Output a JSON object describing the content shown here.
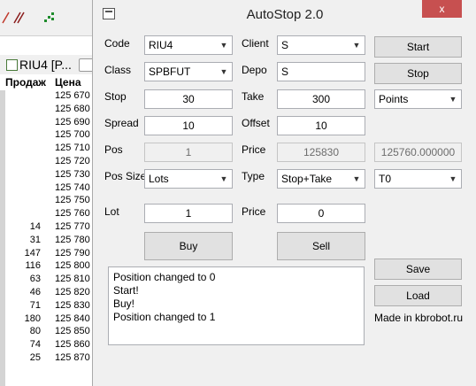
{
  "background_app": {
    "tab_label": "RIU4 [P...",
    "header_sell": "Продаж",
    "header_price": "Цена",
    "rows": [
      {
        "qty": "",
        "price": "125 670"
      },
      {
        "qty": "",
        "price": "125 680"
      },
      {
        "qty": "",
        "price": "125 690"
      },
      {
        "qty": "",
        "price": "125 700"
      },
      {
        "qty": "",
        "price": "125 710"
      },
      {
        "qty": "",
        "price": "125 720"
      },
      {
        "qty": "",
        "price": "125 730"
      },
      {
        "qty": "",
        "price": "125 740"
      },
      {
        "qty": "",
        "price": "125 750"
      },
      {
        "qty": "",
        "price": "125 760"
      },
      {
        "qty": "14",
        "price": "125 770"
      },
      {
        "qty": "31",
        "price": "125 780"
      },
      {
        "qty": "147",
        "price": "125 790"
      },
      {
        "qty": "116",
        "price": "125 800"
      },
      {
        "qty": "63",
        "price": "125 810"
      },
      {
        "qty": "46",
        "price": "125 820"
      },
      {
        "qty": "71",
        "price": "125 830"
      },
      {
        "qty": "180",
        "price": "125 840"
      },
      {
        "qty": "80",
        "price": "125 850"
      },
      {
        "qty": "74",
        "price": "125 860"
      },
      {
        "qty": "25",
        "price": "125 870"
      }
    ]
  },
  "window": {
    "title": "AutoStop 2.0",
    "close_glyph": "x"
  },
  "form": {
    "code_label": "Code",
    "code_value": "RIU4",
    "class_label": "Class",
    "class_value": "SPBFUT",
    "stop_label": "Stop",
    "stop_value": "30",
    "spread_label": "Spread",
    "spread_value": "10",
    "pos_label": "Pos",
    "pos_value": "1",
    "pos_size_label": "Pos Size",
    "pos_size_value": "Lots",
    "lot_label": "Lot",
    "lot_value": "1",
    "client_label": "Client",
    "client_value": "S",
    "depo_label": "Depo",
    "depo_value": "S",
    "take_label": "Take",
    "take_value": "300",
    "offset_label": "Offset",
    "offset_value": "10",
    "price_label": "Price",
    "price_value": "125830",
    "type_label": "Type",
    "type_value": "Stop+Take",
    "price2_label": "Price",
    "price2_value": "0",
    "units_value": "Points",
    "last_price_value": "125760.000000",
    "account_value": "T0"
  },
  "buttons": {
    "start": "Start",
    "stop": "Stop",
    "buy": "Buy",
    "sell": "Sell",
    "save": "Save",
    "load": "Load"
  },
  "log": [
    "Position changed to 0",
    "Start!",
    "Buy!",
    "Position changed to 1"
  ],
  "footer": "Made in kbrobot.ru"
}
